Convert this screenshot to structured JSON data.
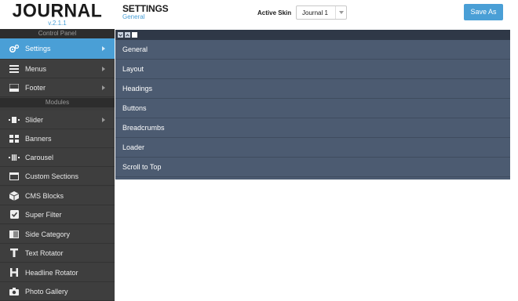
{
  "brand": {
    "logo": "JOURNAL",
    "version": "v.2.1.1"
  },
  "sidebar": {
    "control_panel_heading": "Control Panel",
    "control_items": [
      {
        "label": "Settings",
        "icon": "gears-icon",
        "active": true,
        "has_submenu": true
      },
      {
        "label": "Menus",
        "icon": "hamburger-icon",
        "active": false,
        "has_submenu": true
      },
      {
        "label": "Footer",
        "icon": "footer-icon",
        "active": false,
        "has_submenu": true
      }
    ],
    "modules_heading": "Modules",
    "module_items": [
      {
        "label": "Slider",
        "icon": "slider-icon",
        "has_submenu": true
      },
      {
        "label": "Banners",
        "icon": "grid-icon",
        "has_submenu": false
      },
      {
        "label": "Carousel",
        "icon": "carousel-icon",
        "has_submenu": false
      },
      {
        "label": "Custom Sections",
        "icon": "window-icon",
        "has_submenu": false
      },
      {
        "label": "CMS Blocks",
        "icon": "cube-icon",
        "has_submenu": false
      },
      {
        "label": "Super Filter",
        "icon": "checkbox-icon",
        "has_submenu": false
      },
      {
        "label": "Side Category",
        "icon": "side-panel-icon",
        "has_submenu": false
      },
      {
        "label": "Text Rotator",
        "icon": "text-icon",
        "has_submenu": false
      },
      {
        "label": "Headline Rotator",
        "icon": "heading-icon",
        "has_submenu": false
      },
      {
        "label": "Photo Gallery",
        "icon": "camera-icon",
        "has_submenu": false
      }
    ]
  },
  "header": {
    "title": "SETTINGS",
    "subtitle": "General",
    "skin_label": "Active Skin",
    "skin_value": "Journal 1",
    "save_label": "Save As"
  },
  "panel": {
    "rows": [
      "General",
      "Layout",
      "Headings",
      "Buttons",
      "Breadcrumbs",
      "Loader",
      "Scroll to Top"
    ]
  },
  "colors": {
    "accent": "#4a9fd6",
    "sidebar_bg": "#3e3e3e",
    "panel_bg": "#4c5b71",
    "toolbar_bg": "#2f3847"
  }
}
